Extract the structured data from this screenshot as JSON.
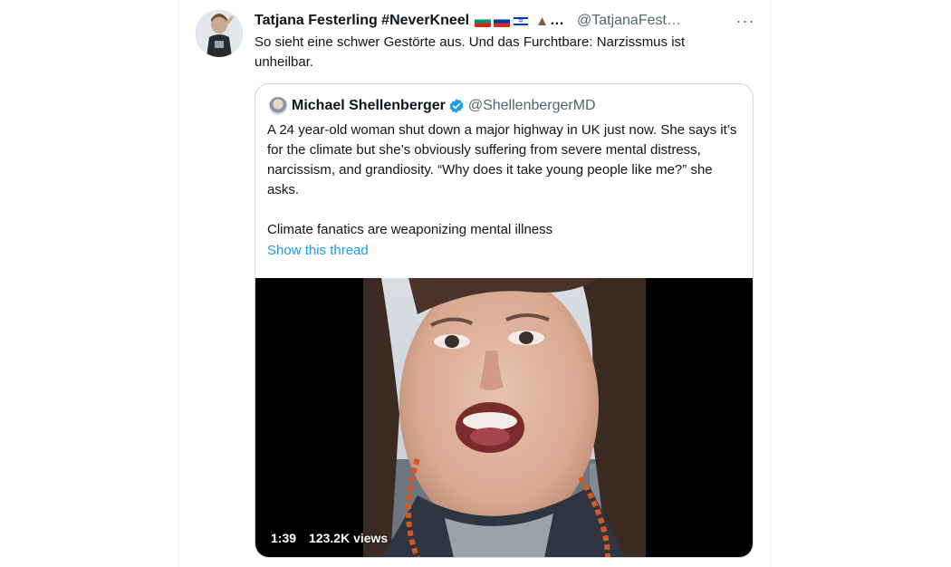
{
  "tweet": {
    "display_name": "Tatjana Festerling #NeverKneel",
    "name_suffix": "…",
    "handle": "@TatjanaFest…",
    "text": "So sieht eine schwer Gestörte aus. Und das Furchtbare: Narzissmus ist unheilbar.",
    "more_label": "···",
    "flags": [
      "bulgaria-flag",
      "russia-flag",
      "israel-flag",
      "volcano-emoji"
    ]
  },
  "quote": {
    "display_name": "Michael Shellenberger",
    "handle": "@ShellenbergerMD",
    "paragraph_1": "A 24 year-old woman shut down a major highway in UK just now. She says it’s for the climate but she’s obviously suffering from severe mental distress, narcissism, and grandiosity. “Why does it take young people like me?” she asks.",
    "paragraph_2": "Climate fanatics are weaponizing mental illness",
    "show_thread": "Show this thread",
    "video": {
      "duration": "1:39",
      "views": "123.2K views"
    }
  },
  "colors": {
    "link": "#1d9bf0",
    "secondary_text": "#536471",
    "border": "#cfd9de",
    "verified": "#1d9bf0"
  }
}
